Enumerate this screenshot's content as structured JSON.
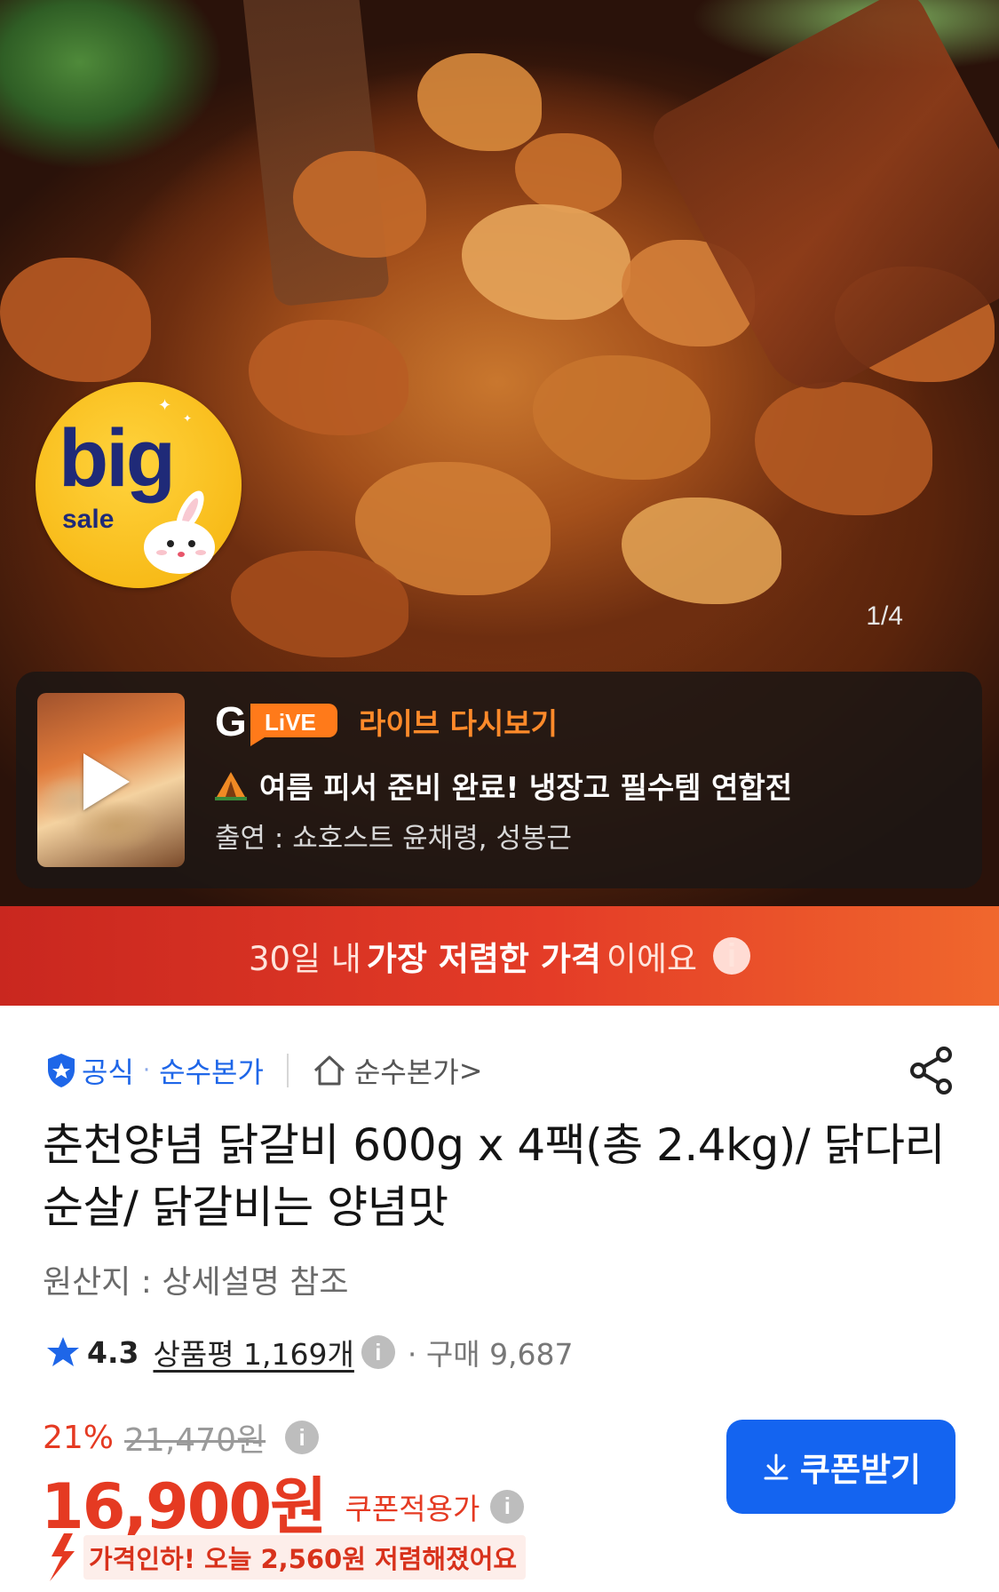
{
  "hero": {
    "image_description_icon": "dakgalbi-photo",
    "badge": {
      "line1": "big",
      "line2": "sale"
    },
    "pager": "1/4"
  },
  "live": {
    "logo_g": "G",
    "logo_live": "LiVE",
    "title": "라이브 다시보기",
    "description": "여름 피서 준비 완료! 냉장고 필수템 연합전",
    "cast": "출연 : 쇼호스트 윤채령, 성봉근"
  },
  "promo": {
    "part1": "30일 내 ",
    "part2": "가장 저렴한 가격",
    "part3": "이에요",
    "info": "i"
  },
  "store": {
    "official_label": "공식",
    "brand_label": "순수본가",
    "store_link": "순수본가",
    "chevron": ">"
  },
  "product": {
    "title": "춘천양념 닭갈비 600g x 4팩(총 2.4kg)/ 닭다리순살/ 닭갈비는 양념맛",
    "origin": "원산지 : 상세설명 참조"
  },
  "rating": {
    "score": "4.3",
    "review_label": "상품평 1,169개",
    "info": "i",
    "purchase": "· 구매 9,687"
  },
  "pricing": {
    "discount": "21%",
    "original_price": "21,470원",
    "price": "16,900원",
    "coupon_label": "쿠폰적용가",
    "info": "i",
    "coupon_button": "쿠폰받기",
    "price_drop": "가격인하! 오늘 2,560원 저렴해졌어요"
  },
  "colors": {
    "accent_red": "#e53a22",
    "brand_blue": "#1464f0",
    "live_orange": "#ff8a2a"
  }
}
